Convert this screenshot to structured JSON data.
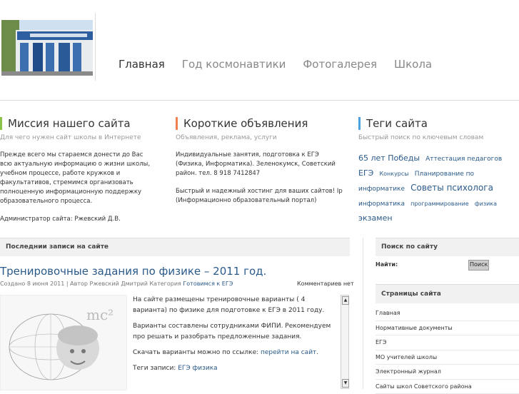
{
  "nav": {
    "items": [
      "Главная",
      "Год космонавтики",
      "Фотогалерея",
      "Школа"
    ],
    "active_index": 0
  },
  "mission": {
    "title": "Миссия нашего сайта",
    "subtitle": "Для чего нужен сайт школы в Интернете",
    "body": "Прежде всего мы стараемся донести до Вас всю актуальную информацию о жизни школы, учебном процессе, работе кружков и факультативов, стремимся организовать полноценную информационную поддержку образовательного процесса.",
    "admin": "Администратор сайта: Ржевский Д.В."
  },
  "announcements": {
    "title": "Короткие объявления",
    "subtitle": "Объявления, реклама, услуги",
    "item1": "Индивидуальные занятия, подготовка к ЕГЭ (Физика, Информатика). Зеленокумск, Советский район. тел. 8 918 7412847",
    "item2": "Быстрый и надежный хостинг для ваших сайтов! Ip (Информационно образовательный портал)"
  },
  "tags_box": {
    "title": "Теги сайта",
    "subtitle": "Быстрый поиск по ключевым словам",
    "tags": [
      {
        "text": "65 лет Победы",
        "size": "t1"
      },
      {
        "text": "Аттестация педагогов",
        "size": "t2"
      },
      {
        "text": "ЕГЭ",
        "size": "t1"
      },
      {
        "text": "Конкурсы",
        "size": "t4"
      },
      {
        "text": "Планирование по информатике",
        "size": "t2"
      },
      {
        "text": "Советы психолога",
        "size": "t3"
      },
      {
        "text": "информатика",
        "size": "t2"
      },
      {
        "text": "программирование",
        "size": "t4"
      },
      {
        "text": "физика",
        "size": "t4"
      },
      {
        "text": "экзамен",
        "size": "t1"
      }
    ]
  },
  "latest": {
    "header": "Последнии записи на сайте",
    "post_title": "Тренировочные задания по физике – 2011 год.",
    "meta_prefix": "Создано 8 июня 2011 | Автор Ржевский Дмитрий Категория ",
    "meta_category": "Готовимся к ЕГЭ",
    "comments": "Комментариев нет",
    "p1": "На сайте размещены тренировочные варианты ( 4 варианта) по физике для подготовке к ЕГЭ в 2011 году.",
    "p2": "Варианты составлены сотрудниками ФИПИ. Рекомендуем про решать и разобрать предложенные задания.",
    "p3_prefix": "Скачать варианты можно по ссылке: ",
    "p3_link": "перейти на сайт",
    "p3_suffix": ".",
    "tags_prefix": "Теги записи: ",
    "tags_links": "ЕГЭ физика"
  },
  "search": {
    "header": "Поиск по сайту",
    "label": "Найти:",
    "value": "",
    "button": "Поиск"
  },
  "pages": {
    "header": "Страницы сайта",
    "items": [
      "Главная",
      "Нормативные документы",
      "ЕГЭ",
      "МО учителей школы",
      "Электронный журнал",
      "Сайты школ Советского района"
    ]
  },
  "colors": {
    "mission_accent": "#8bc34a",
    "announce_accent": "#f08050",
    "tags_accent": "#4aa3df",
    "link": "#2a5a8a"
  }
}
